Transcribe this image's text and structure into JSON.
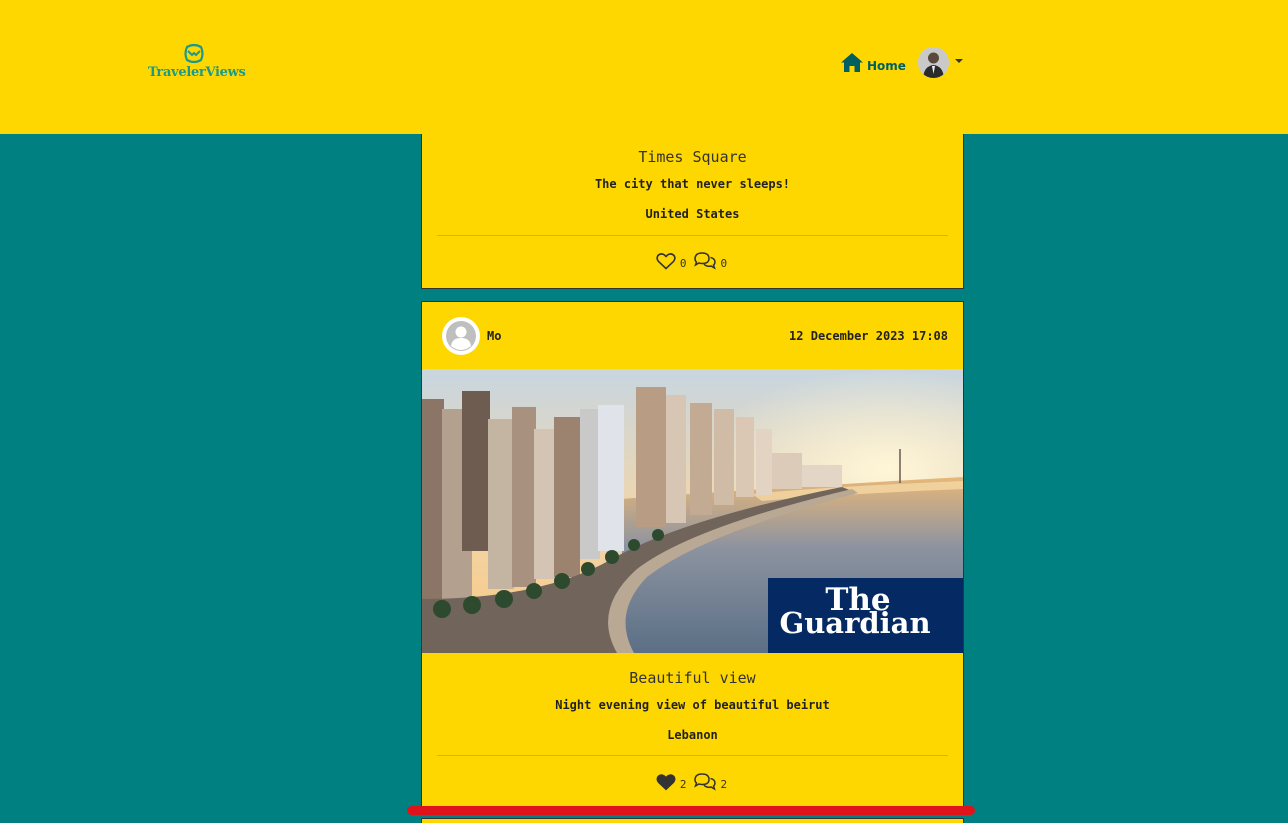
{
  "navbar": {
    "brand": "TravelerViews",
    "home_label": "Home",
    "colors": {
      "bar": "#FFD700",
      "brand_text": "#1a9a8a",
      "home": "#005f5f"
    }
  },
  "page": {
    "background": "#008080"
  },
  "posts": [
    {
      "title": "Times Square",
      "description": "The city that never sleeps!",
      "country": "United States",
      "likes": "0",
      "comments": "0",
      "liked": false
    },
    {
      "author": "Mo",
      "date": "12 December 2023 17:08",
      "image_alt": "Beirut seafront at sunset",
      "image_watermark_line1": "The",
      "image_watermark_line2": "Guardian",
      "title": "Beautiful view",
      "description": "Night evening view of beautiful beirut",
      "country": "Lebanon",
      "likes": "2",
      "comments": "2",
      "liked": true
    }
  ]
}
